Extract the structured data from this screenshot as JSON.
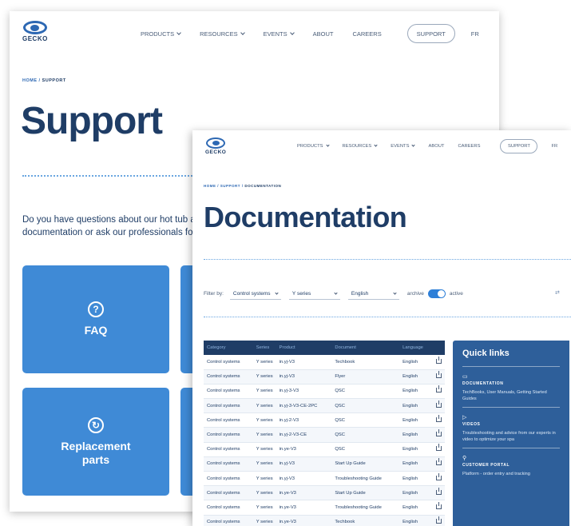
{
  "brand": {
    "name": "GECKO"
  },
  "back_page": {
    "nav": {
      "products": "PRODUCTS",
      "resources": "RESOURCES",
      "events": "EVENTS",
      "about": "ABOUT",
      "careers": "CAREERS",
      "support": "SUPPORT",
      "lang": "FR"
    },
    "breadcrumb": {
      "home": "HOME",
      "sep": "/",
      "current": "SUPPORT"
    },
    "title": "Support",
    "intro_line1": "Do you have questions about our hot tub acc",
    "intro_line2": "documentation or ask our professionals for a",
    "tiles": [
      {
        "icon": "?",
        "label": "FAQ"
      },
      {
        "icon": "↻",
        "label": "Replacement parts"
      }
    ]
  },
  "front_page": {
    "nav": {
      "products": "PRODUCTS",
      "resources": "RESOURCES",
      "events": "EVENTS",
      "about": "ABOUT",
      "careers": "CAREERS",
      "support": "SUPPORT",
      "lang": "FR"
    },
    "breadcrumb": {
      "home": "HOME",
      "sep1": "/",
      "support": "SUPPORT",
      "sep2": "/",
      "current": "DOCUMENTATION"
    },
    "title": "Documentation",
    "filters": {
      "label": "Filter by:",
      "category": "Control systems",
      "series": "Y series",
      "language": "English",
      "archive_label": "archive",
      "active_label": "active"
    },
    "table": {
      "headers": [
        "Category",
        "Series",
        "Product",
        "Document",
        "Language"
      ],
      "rows": [
        [
          "Control systems",
          "Y series",
          "in.yj-V3",
          "Techbook",
          "English"
        ],
        [
          "Control systems",
          "Y series",
          "in.yj-V3",
          "Flyer",
          "English"
        ],
        [
          "Control systems",
          "Y series",
          "in.yj-3-V3",
          "QSC",
          "English"
        ],
        [
          "Control systems",
          "Y series",
          "in.yj-3-V3-CE-2PC",
          "QSC",
          "English"
        ],
        [
          "Control systems",
          "Y series",
          "in.yj-2-V3",
          "QSC",
          "English"
        ],
        [
          "Control systems",
          "Y series",
          "in.yj-2-V3-CE",
          "QSC",
          "English"
        ],
        [
          "Control systems",
          "Y series",
          "in.ye-V3",
          "QSC",
          "English"
        ],
        [
          "Control systems",
          "Y series",
          "in.yj-V3",
          "Start Up Guide",
          "English"
        ],
        [
          "Control systems",
          "Y series",
          "in.yj-V3",
          "Troubleshooting Guide",
          "English"
        ],
        [
          "Control systems",
          "Y series",
          "in.ye-V3",
          "Start Up Guide",
          "English"
        ],
        [
          "Control systems",
          "Y series",
          "in.ye-V3",
          "Troubleshooting Guide",
          "English"
        ],
        [
          "Control systems",
          "Y series",
          "in.ye-V3",
          "Techbook",
          "English"
        ]
      ]
    },
    "quick_links": {
      "title": "Quick links",
      "sections": [
        {
          "icon": "▭",
          "title": "DOCUMENTATION",
          "text": "TechBooks, User Manuals, Getting Started Guides"
        },
        {
          "icon": "▷",
          "title": "VIDEOS",
          "text": "Troubleshooting and advice from our experts in video to optimize your spa"
        },
        {
          "icon": "⚲",
          "title": "CUSTOMER PORTAL",
          "text": "Platform - order entry and tracking"
        }
      ]
    }
  },
  "colors": {
    "navy": "#1f3d66",
    "blue": "#3f8ad6",
    "quicklinks": "#2e5f9a",
    "accent": "#2d7fd8"
  }
}
